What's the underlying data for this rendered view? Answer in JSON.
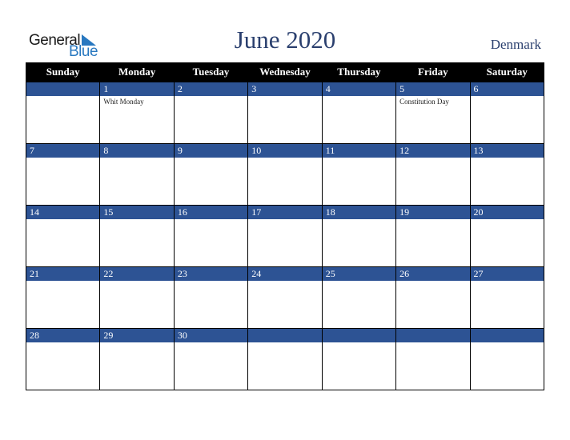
{
  "logo": {
    "general": "General",
    "blue": "Blue"
  },
  "title": "June 2020",
  "country": "Denmark",
  "weekdays": [
    "Sunday",
    "Monday",
    "Tuesday",
    "Wednesday",
    "Thursday",
    "Friday",
    "Saturday"
  ],
  "weeks": [
    [
      {
        "day": "",
        "holiday": ""
      },
      {
        "day": "1",
        "holiday": "Whit Monday"
      },
      {
        "day": "2",
        "holiday": ""
      },
      {
        "day": "3",
        "holiday": ""
      },
      {
        "day": "4",
        "holiday": ""
      },
      {
        "day": "5",
        "holiday": "Constitution Day"
      },
      {
        "day": "6",
        "holiday": ""
      }
    ],
    [
      {
        "day": "7",
        "holiday": ""
      },
      {
        "day": "8",
        "holiday": ""
      },
      {
        "day": "9",
        "holiday": ""
      },
      {
        "day": "10",
        "holiday": ""
      },
      {
        "day": "11",
        "holiday": ""
      },
      {
        "day": "12",
        "holiday": ""
      },
      {
        "day": "13",
        "holiday": ""
      }
    ],
    [
      {
        "day": "14",
        "holiday": ""
      },
      {
        "day": "15",
        "holiday": ""
      },
      {
        "day": "16",
        "holiday": ""
      },
      {
        "day": "17",
        "holiday": ""
      },
      {
        "day": "18",
        "holiday": ""
      },
      {
        "day": "19",
        "holiday": ""
      },
      {
        "day": "20",
        "holiday": ""
      }
    ],
    [
      {
        "day": "21",
        "holiday": ""
      },
      {
        "day": "22",
        "holiday": ""
      },
      {
        "day": "23",
        "holiday": ""
      },
      {
        "day": "24",
        "holiday": ""
      },
      {
        "day": "25",
        "holiday": ""
      },
      {
        "day": "26",
        "holiday": ""
      },
      {
        "day": "27",
        "holiday": ""
      }
    ],
    [
      {
        "day": "28",
        "holiday": ""
      },
      {
        "day": "29",
        "holiday": ""
      },
      {
        "day": "30",
        "holiday": ""
      },
      {
        "day": "",
        "holiday": ""
      },
      {
        "day": "",
        "holiday": ""
      },
      {
        "day": "",
        "holiday": ""
      },
      {
        "day": "",
        "holiday": ""
      }
    ]
  ],
  "colors": {
    "header_bg": "#000000",
    "day_bar": "#2d5394",
    "title": "#2a3f6e",
    "logo_blue": "#2878c0"
  }
}
